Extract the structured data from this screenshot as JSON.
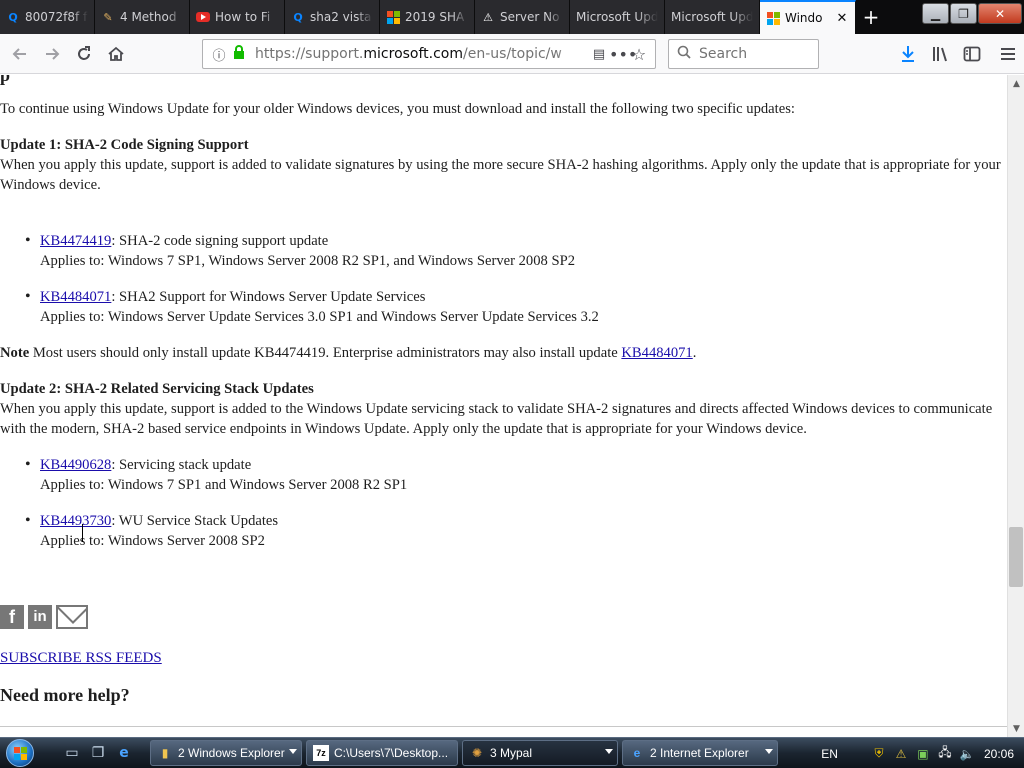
{
  "browser": {
    "tabs": [
      {
        "label": "80072f8f f",
        "favicon": "search-icon"
      },
      {
        "label": "4 Method",
        "favicon": "page-icon"
      },
      {
        "label": "How to Fi",
        "favicon": "youtube-icon"
      },
      {
        "label": "sha2 vista",
        "favicon": "search-icon"
      },
      {
        "label": "2019 SHA",
        "favicon": "microsoft-icon"
      },
      {
        "label": "Server No",
        "favicon": "warning-icon"
      },
      {
        "label": "Microsoft Upd",
        "favicon": "none"
      },
      {
        "label": "Microsoft Upd",
        "favicon": "none"
      },
      {
        "label": "Windo",
        "favicon": "microsoft-icon",
        "active": true
      }
    ],
    "new_tab_symbol": "+",
    "url_prefix": "https://support.",
    "url_domain": "microsoft.com",
    "url_path": "/en-us/topic/w",
    "search_placeholder": "Search"
  },
  "page": {
    "intro": "To continue using Windows Update for your older Windows devices, you must download and install the following two specific updates:",
    "update1": {
      "heading": "Update 1: SHA-2 Code Signing Support",
      "desc": "When you apply this update, support is added to validate signatures by using the more secure SHA-2 hashing algorithms. Apply only the update that is appropriate for your Windows device.",
      "items": [
        {
          "kb": "KB4474419",
          "title": ": SHA-2 code signing support update",
          "applies": "Applies to: Windows 7 SP1, Windows Server 2008 R2 SP1, and Windows Server 2008 SP2"
        },
        {
          "kb": "KB4484071",
          "title": ": SHA2 Support for Windows Server Update Services",
          "applies": "Applies to: Windows Server Update Services 3.0 SP1 and Windows Server Update Services 3.2"
        }
      ]
    },
    "note": {
      "label": "Note",
      "text": " Most users should only install update KB4474419. Enterprise administrators may also install update ",
      "link": "KB4484071",
      "end": "."
    },
    "update2": {
      "heading": "Update 2: SHA-2 Related Servicing Stack Updates",
      "desc": "When you apply this update, support is added to the Windows Update servicing stack to validate SHA-2 signatures and directs affected Windows devices to communicate with the modern, SHA-2 based service endpoints in Windows Update. Apply only the update that is appropriate for your Windows device.",
      "items": [
        {
          "kb": "KB4490628",
          "title": ": Servicing stack update",
          "applies": "Applies to: Windows 7 SP1 and Windows Server 2008 R2 SP1"
        },
        {
          "kb": "KB4493730",
          "title": ": WU Service Stack Updates",
          "applies": "Applies to: Windows Server 2008 SP2"
        }
      ]
    },
    "social": {
      "facebook": "f",
      "linkedin": "in"
    },
    "rss": "SUBSCRIBE RSS FEEDS",
    "need_help": "Need more help?"
  },
  "taskbar": {
    "buttons": [
      {
        "label": "2 Windows Explorer",
        "icon": "folder-icon"
      },
      {
        "label": "C:\\Users\\7\\Desktop...",
        "icon": "7zip-icon"
      },
      {
        "label": "3 Mypal",
        "icon": "mypal-icon"
      },
      {
        "label": "2 Internet Explorer",
        "icon": "ie-icon"
      }
    ],
    "lang": "EN",
    "clock": "20:06"
  },
  "colors": {
    "link": "#1a0dab",
    "visited_link": "#551a8b",
    "accent": "#0a84ff",
    "ms_red": "#f25022",
    "ms_green": "#7fba00",
    "ms_blue": "#00a4ef",
    "ms_yellow": "#ffb900"
  }
}
